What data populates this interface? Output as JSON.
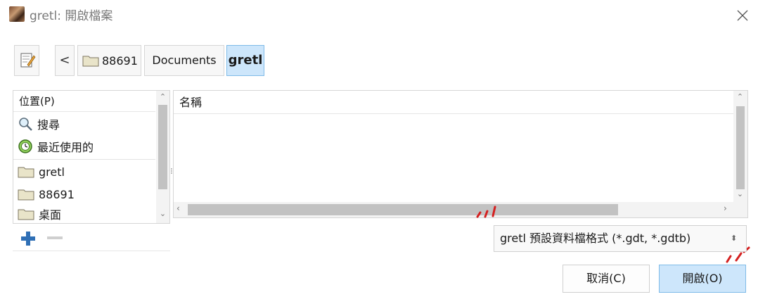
{
  "window": {
    "title": "gretl: 開啟檔案"
  },
  "pathbar": {
    "back_symbol": "<",
    "crumbs": [
      "88691",
      "Documents",
      "gretl"
    ],
    "active_crumb": "gretl"
  },
  "places": {
    "header": "位置(P)",
    "items": [
      {
        "label": "搜尋",
        "icon": "search-icon"
      },
      {
        "label": "最近使用的",
        "icon": "recent-icon"
      },
      {
        "label": "gretl",
        "icon": "folder-icon"
      },
      {
        "label": "88691",
        "icon": "folder-icon"
      },
      {
        "label": "桌面",
        "icon": "folder-icon"
      }
    ]
  },
  "filelist": {
    "column_name": "名稱"
  },
  "filter": {
    "selected": "gretl 預設資料檔格式 (*.gdt, *.gdtb)"
  },
  "buttons": {
    "cancel": "取消(C)",
    "open": "開啟(O)"
  },
  "colors": {
    "accent": "#cde6fb",
    "accent_border": "#7fbbe8",
    "annotation_red": "#d42020",
    "add_icon_blue": "#2f6fb5"
  }
}
